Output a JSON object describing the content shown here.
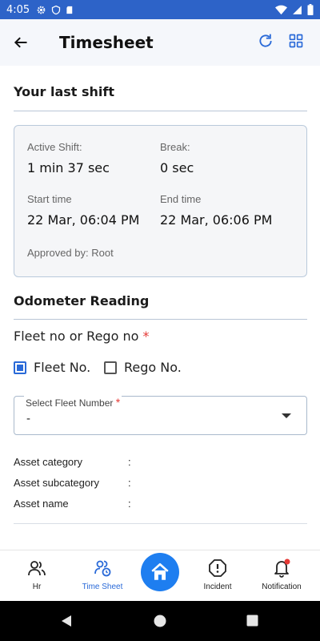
{
  "status_bar": {
    "time": "4:05",
    "icons": [
      "gear-icon",
      "shield-icon",
      "sd-card-icon",
      "wifi-icon",
      "signal-icon",
      "battery-icon"
    ]
  },
  "app_bar": {
    "title": "Timesheet",
    "icons": [
      "back-arrow-icon",
      "refresh-icon",
      "grid-icon"
    ]
  },
  "last_shift": {
    "heading": "Your last shift",
    "active_shift_label": "Active Shift:",
    "active_shift_value": "1 min 37 sec",
    "break_label": "Break:",
    "break_value": "0 sec",
    "start_label": "Start time",
    "start_value": "22 Mar, 06:04 PM",
    "end_label": "End time",
    "end_value": "22 Mar, 06:06 PM",
    "approved_by": "Approved by: Root"
  },
  "odometer": {
    "heading": "Odometer Reading",
    "fleet_rego_label": "Fleet no or Rego no",
    "required_mark": "*",
    "fleet_option": "Fleet No.",
    "fleet_checked": true,
    "rego_option": "Rego No.",
    "rego_checked": false,
    "select_caption": "Select Fleet Number",
    "select_value": "-",
    "assets": [
      {
        "label": "Asset category",
        "sep": ":"
      },
      {
        "label": "Asset subcategory",
        "sep": ":"
      },
      {
        "label": "Asset name",
        "sep": ":"
      }
    ]
  },
  "bottom_nav": {
    "items": [
      {
        "label": "Hr",
        "icon": "people-icon"
      },
      {
        "label": "Time Sheet",
        "icon": "timesheet-people-icon"
      },
      {
        "label": "",
        "icon": "home-icon"
      },
      {
        "label": "Incident",
        "icon": "alert-octagon-icon"
      },
      {
        "label": "Notification",
        "icon": "bell-icon"
      }
    ],
    "active": "Time Sheet"
  },
  "colors": {
    "status_bar": "#2d63c8",
    "accent": "#2a6ad8",
    "home_button": "#1e7ef0",
    "required": "#e53935"
  }
}
